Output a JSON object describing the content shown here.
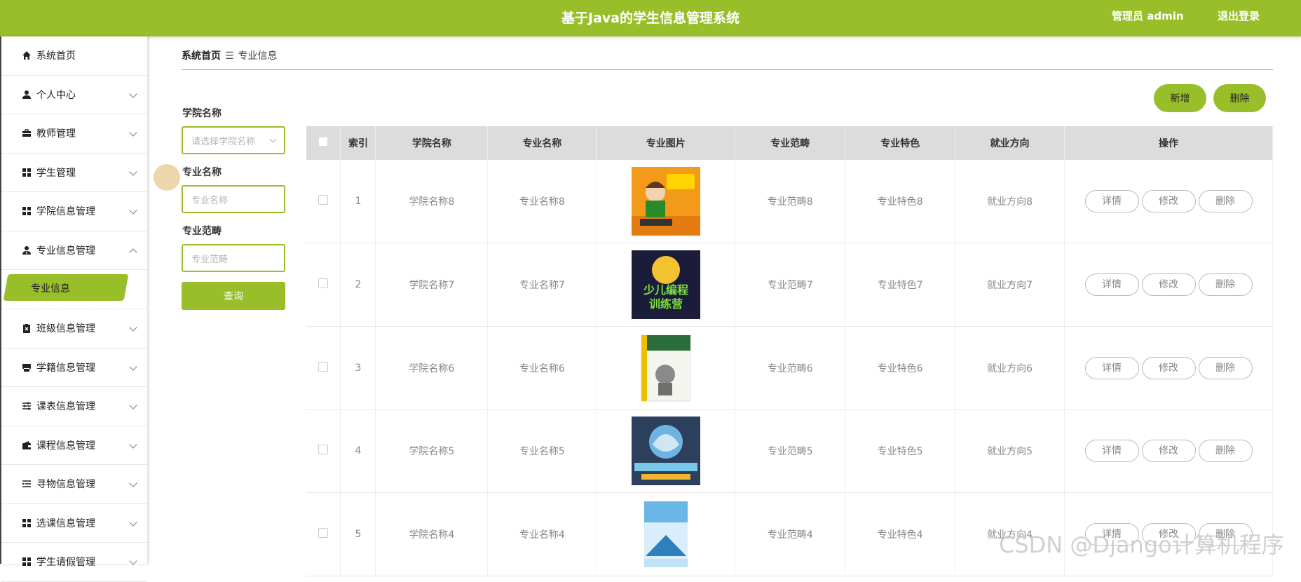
{
  "header": {
    "title": "基于Java的学生信息管理系统",
    "user": "管理员 admin",
    "logout": "退出登录"
  },
  "sidebar": {
    "items": [
      {
        "label": "系统首页",
        "icon": "home-icon"
      },
      {
        "label": "个人中心",
        "icon": "user-icon"
      },
      {
        "label": "教师管理",
        "icon": "briefcase-icon"
      },
      {
        "label": "学生管理",
        "icon": "grid-icon"
      },
      {
        "label": "学院信息管理",
        "icon": "grid-icon"
      },
      {
        "label": "专业信息管理",
        "icon": "user-tie-icon"
      },
      {
        "label": "专业信息",
        "icon": ""
      },
      {
        "label": "班级信息管理",
        "icon": "clipboard-icon"
      },
      {
        "label": "学籍信息管理",
        "icon": "printer-icon"
      },
      {
        "label": "课表信息管理",
        "icon": "sliders-icon"
      },
      {
        "label": "课程信息管理",
        "icon": "wallet-icon"
      },
      {
        "label": "寻物信息管理",
        "icon": "list-icon"
      },
      {
        "label": "选课信息管理",
        "icon": "grid-icon"
      },
      {
        "label": "学生请假管理",
        "icon": "grid-icon"
      }
    ]
  },
  "breadcrumb": {
    "home": "系统首页",
    "sep": "☰",
    "current": "专业信息"
  },
  "actions": {
    "add": "新增",
    "delete": "删除"
  },
  "search": {
    "college_label": "学院名称",
    "college_placeholder": "请选择学院名称",
    "major_label": "专业名称",
    "major_placeholder": "专业名称",
    "category_label": "专业范畴",
    "category_placeholder": "专业范畴",
    "query": "查询"
  },
  "table": {
    "headers": [
      "索引",
      "学院名称",
      "专业名称",
      "专业图片",
      "专业范畴",
      "专业特色",
      "就业方向",
      "操作"
    ],
    "rows": [
      {
        "index": "1",
        "college": "学院名称8",
        "major": "专业名称8",
        "category": "专业范畴8",
        "feature": "专业特色8",
        "career": "就业方向8",
        "img": "orange"
      },
      {
        "index": "2",
        "college": "学院名称7",
        "major": "专业名称7",
        "category": "专业范畴7",
        "feature": "专业特色7",
        "career": "就业方向7",
        "img": "dark"
      },
      {
        "index": "3",
        "college": "学院名称6",
        "major": "专业名称6",
        "category": "专业范畴6",
        "feature": "专业特色6",
        "career": "就业方向6",
        "img": "book"
      },
      {
        "index": "4",
        "college": "学院名称5",
        "major": "专业名称5",
        "category": "专业范畴5",
        "feature": "专业特色5",
        "career": "就业方向5",
        "img": "blue"
      },
      {
        "index": "5",
        "college": "学院名称4",
        "major": "专业名称4",
        "category": "专业范畴4",
        "feature": "专业特色4",
        "career": "就业方向4",
        "img": "light"
      }
    ],
    "op_labels": {
      "detail": "详情",
      "edit": "修改",
      "delete": "删除"
    }
  },
  "watermark": "CSDN @Django计算机程序",
  "colors": {
    "accent": "#98bf2a"
  }
}
